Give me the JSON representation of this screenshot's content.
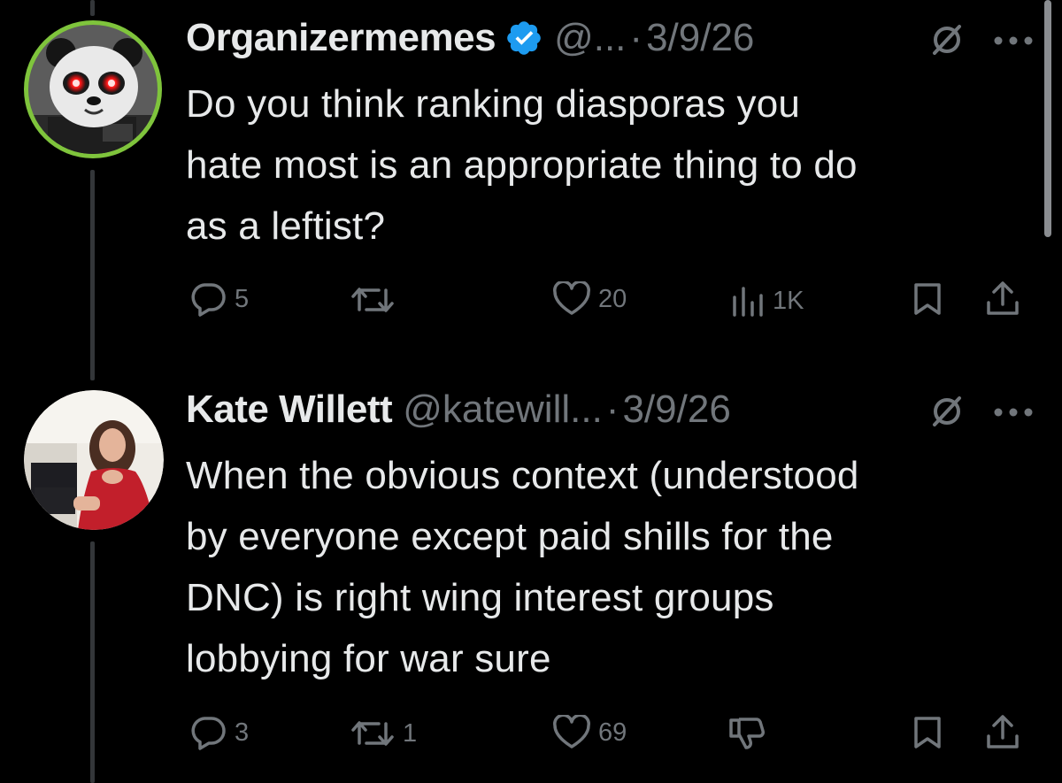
{
  "colors": {
    "background": "#000000",
    "text_primary": "#e7e9ea",
    "text_secondary": "#71767b",
    "verified_badge": "#1d9bf0",
    "avatar_ring": "#7fc43c"
  },
  "tweets": [
    {
      "author": {
        "display_name": "Organizermemes",
        "verified": true,
        "handle": "@...",
        "avatar": "panda-avatar"
      },
      "separator": "·",
      "timestamp": "3/9/26",
      "text": "Do you think ranking diasporas you\nhate most is an appropriate thing to do\nas a leftist?",
      "actions": {
        "replies": "5",
        "reposts": "",
        "likes": "20",
        "views": "1K"
      },
      "icons": [
        "reply-icon",
        "repost-icon",
        "like-icon",
        "views-icon",
        "bookmark-icon",
        "share-icon"
      ]
    },
    {
      "author": {
        "display_name": "Kate Willett",
        "verified": false,
        "handle": "@katewill...",
        "avatar": "profile-photo-avatar"
      },
      "separator": "·",
      "timestamp": "3/9/26",
      "text": "When the obvious context (understood\nby everyone except paid shills for the\nDNC) is right wing interest groups\nlobbying for war sure",
      "actions": {
        "replies": "3",
        "reposts": "1",
        "likes": "69"
      },
      "icons": [
        "reply-icon",
        "repost-icon",
        "like-icon",
        "downvote-icon",
        "bookmark-icon",
        "share-icon"
      ]
    }
  ]
}
